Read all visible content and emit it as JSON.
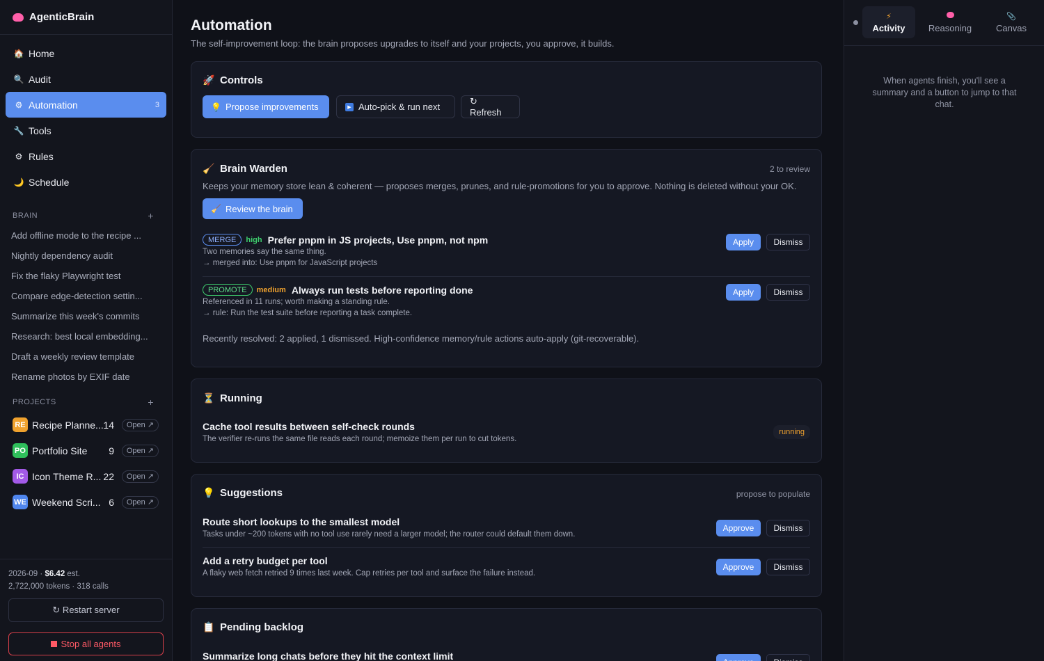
{
  "app": {
    "name": "AgenticBrain"
  },
  "nav": [
    {
      "label": "Home",
      "icon": "house-icon",
      "glyph": "🏠"
    },
    {
      "label": "Audit",
      "icon": "magnifier-icon",
      "glyph": "🔍"
    },
    {
      "label": "Automation",
      "icon": "gear-icon",
      "glyph": "⚙",
      "count": "3",
      "active": true
    },
    {
      "label": "Tools",
      "icon": "wrench-icon",
      "glyph": "🔧"
    },
    {
      "label": "Rules",
      "icon": "gear-icon",
      "glyph": "⚙"
    },
    {
      "label": "Schedule",
      "icon": "moon-icon",
      "glyph": "🌙"
    }
  ],
  "brain": {
    "heading": "BRAIN",
    "items": [
      "Add offline mode to the recipe ...",
      "Nightly dependency audit",
      "Fix the flaky Playwright test",
      "Compare edge-detection settin...",
      "Summarize this week's commits",
      "Research: best local embedding...",
      "Draft a weekly review template",
      "Rename photos by EXIF date"
    ]
  },
  "projects": {
    "heading": "PROJECTS",
    "open_label": "Open ↗",
    "items": [
      {
        "badge": "RE",
        "name": "Recipe Planne...",
        "count": "14",
        "color": "#f0a22e"
      },
      {
        "badge": "PO",
        "name": "Portfolio Site",
        "count": "9",
        "color": "#2fbf5b"
      },
      {
        "badge": "IC",
        "name": "Icon Theme R...",
        "count": "22",
        "color": "#a35ae8"
      },
      {
        "badge": "WE",
        "name": "Weekend Scri...",
        "count": "6",
        "color": "#4f86ee"
      }
    ]
  },
  "footer": {
    "usage_prefix": "2026-09 · ",
    "cost": "$6.42",
    "usage_suffix": " est.",
    "tokens": "2,722,000 tokens · 318 calls",
    "restart": "↻ Restart server",
    "stop": "Stop all agents"
  },
  "page": {
    "title": "Automation",
    "subtitle": "The self-improvement loop: the brain proposes upgrades to itself and your projects, you approve, it builds."
  },
  "controls": {
    "title": "Controls",
    "propose": "Propose improvements",
    "autopick": "Auto-pick & run next",
    "refresh": "↻ Refresh"
  },
  "warden": {
    "title": "Brain Warden",
    "meta": "2 to review",
    "description": "Keeps your memory store lean & coherent — proposes merges, prunes, and rule-promotions for you to approve. Nothing is deleted without your OK.",
    "review_button": "Review the brain",
    "apply": "Apply",
    "dismiss": "Dismiss",
    "items": [
      {
        "tag": "MERGE",
        "priority": "high",
        "title": "Prefer pnpm in JS projects, Use pnpm, not npm",
        "line1": "Two memories say the same thing.",
        "line2": "→ merged into: Use pnpm for JavaScript projects"
      },
      {
        "tag": "PROMOTE",
        "priority": "medium",
        "title": "Always run tests before reporting done",
        "line1": "Referenced in 11 runs; worth making a standing rule.",
        "line2": "→ rule: Run the test suite before reporting a task complete."
      }
    ],
    "resolved": "Recently resolved: 2 applied, 1 dismissed. High-confidence memory/rule actions auto-apply (git-recoverable)."
  },
  "running": {
    "title": "Running",
    "item_title": "Cache tool results between self-check rounds",
    "item_desc": "The verifier re-runs the same file reads each round; memoize them per run to cut tokens.",
    "status": "running"
  },
  "suggestions": {
    "title": "Suggestions",
    "meta": "propose to populate",
    "approve": "Approve",
    "dismiss": "Dismiss",
    "items": [
      {
        "title": "Route short lookups to the smallest model",
        "desc": "Tasks under ~200 tokens with no tool use rarely need a larger model; the router could default them down."
      },
      {
        "title": "Add a retry budget per tool",
        "desc": "A flaky web fetch retried 9 times last week. Cap retries per tool and surface the failure instead."
      }
    ]
  },
  "backlog": {
    "title": "Pending backlog",
    "item_title": "Summarize long chats before they hit the context limit",
    "approve": "Approve",
    "dismiss": "Dismiss"
  },
  "right_panel": {
    "tabs": [
      {
        "label": "Activity",
        "icon": "lightning-icon",
        "active": true
      },
      {
        "label": "Reasoning",
        "icon": "brain-icon"
      },
      {
        "label": "Canvas",
        "icon": "paperclip-icon"
      }
    ],
    "empty_text": "When agents finish, you'll see a summary and a button to jump to that chat."
  },
  "colors": {
    "accent": "#5a8dee",
    "success": "#3ecf6e",
    "warning": "#f0a22e",
    "danger": "#ff5a66"
  }
}
